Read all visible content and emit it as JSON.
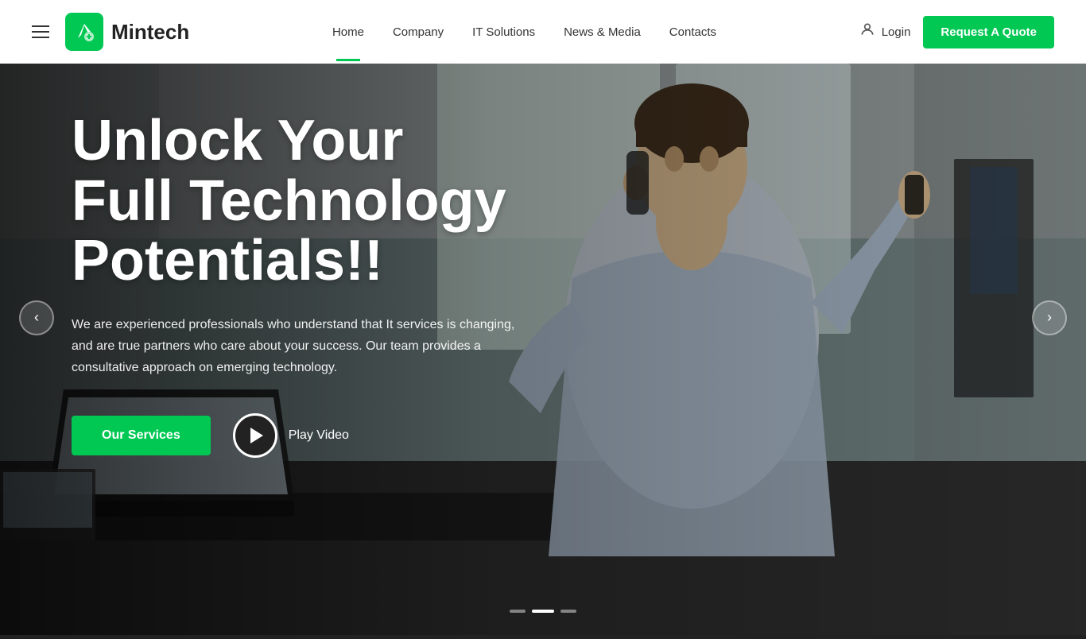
{
  "brand": {
    "name": "Mintech",
    "logo_alt": "Mintech Logo"
  },
  "navbar": {
    "hamburger_label": "menu",
    "nav_items": [
      {
        "id": "home",
        "label": "Home",
        "active": true
      },
      {
        "id": "company",
        "label": "Company",
        "active": false
      },
      {
        "id": "it-solutions",
        "label": "IT Solutions",
        "active": false
      },
      {
        "id": "news-media",
        "label": "News & Media",
        "active": false
      },
      {
        "id": "contacts",
        "label": "Contacts",
        "active": false
      }
    ],
    "login_label": "Login",
    "request_quote_label": "Request A Quote"
  },
  "hero": {
    "title_line1": "Unlock Your",
    "title_line2": "Full Technology",
    "title_line3": "Potentials!!",
    "subtitle": "We are experienced professionals who understand that It services is changing, and are true partners who care about your success. Our team provides a consultative approach on emerging technology.",
    "cta_primary": "Our Services",
    "cta_video": "Play Video"
  },
  "carousel": {
    "prev_label": "‹",
    "next_label": "›",
    "dots": [
      {
        "active": false
      },
      {
        "active": true
      },
      {
        "active": false
      }
    ]
  },
  "colors": {
    "accent": "#00c853",
    "dark": "#222222",
    "white": "#ffffff"
  }
}
